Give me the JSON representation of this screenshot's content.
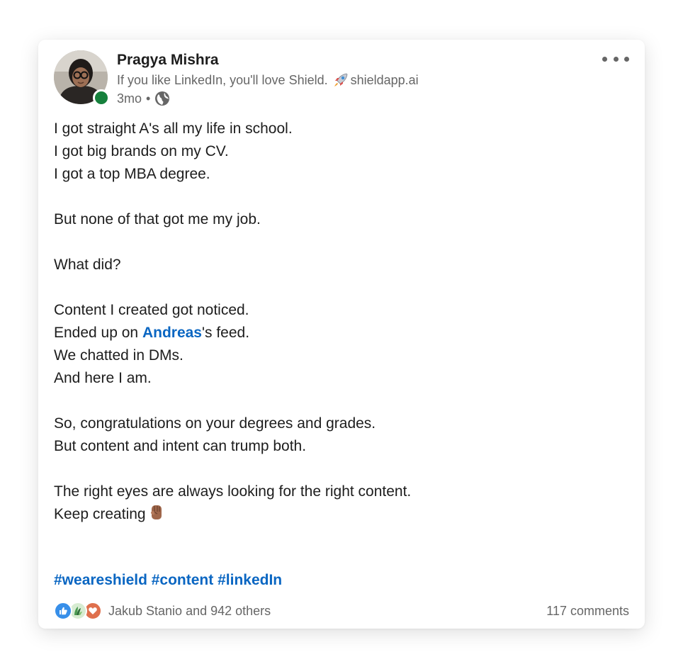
{
  "post": {
    "author": {
      "name": "Pragya Mishra",
      "headline": "If you like LinkedIn, you'll love Shield.",
      "headline_link": "shieldapp.ai",
      "time": "3mo",
      "separator": "•",
      "visibility_icon": "globe-icon",
      "online_status_color": "#16803c"
    },
    "more_icon": "more-horizontal-icon",
    "body": {
      "p1": [
        "I got straight A's all my life in school.",
        "I got big brands on my CV.",
        "I got a top MBA degree."
      ],
      "p2": "But none of that got me my job.",
      "p3": "What did?",
      "p4_line1": "Content I created got noticed.",
      "p4_line2_prefix": "Ended up on ",
      "p4_line2_mention": "Andreas",
      "p4_line2_suffix": "'s feed.",
      "p4_line3": "We chatted in DMs.",
      "p4_line4": "And here I am.",
      "p5": [
        "So, congratulations on your degrees and grades.",
        "But content and intent can trump both."
      ],
      "p6_line1": "The right eyes are always looking for the right content.",
      "p6_line2": "Keep creating",
      "p6_emoji": "raised-fist-icon"
    },
    "hashtags": [
      "#weareshield",
      "#content",
      "#linkedIn"
    ],
    "social": {
      "reaction_icons": [
        "like-icon",
        "support-icon",
        "love-icon"
      ],
      "reactions_text": "Jakub Stanio and 942 others",
      "comments_text": "117 comments"
    },
    "colors": {
      "link": "#0a66c2",
      "text": "#1d1d1d",
      "secondary_text": "#666666"
    }
  }
}
